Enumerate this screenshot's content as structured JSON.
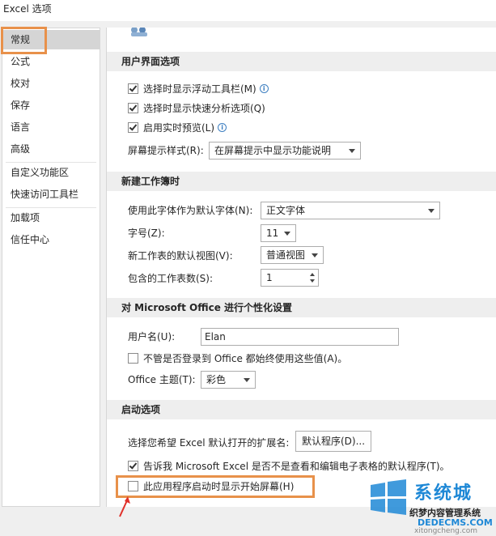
{
  "window": {
    "title": "Excel 选项"
  },
  "sidebar": {
    "items": [
      {
        "label": "常规",
        "selected": true
      },
      {
        "label": "公式"
      },
      {
        "label": "校对"
      },
      {
        "label": "保存"
      },
      {
        "label": "语言"
      },
      {
        "label": "高级"
      },
      {
        "label": "自定义功能区"
      },
      {
        "label": "快速访问工具栏"
      },
      {
        "label": "加载项"
      },
      {
        "label": "信任中心"
      }
    ]
  },
  "ui_options": {
    "header": "用户界面选项",
    "mini_toolbar": {
      "label": "选择时显示浮动工具栏(M)",
      "checked": true
    },
    "quick_analysis": {
      "label": "选择时显示快速分析选项(Q)",
      "checked": true
    },
    "live_preview": {
      "label": "启用实时预览(L)",
      "checked": true
    },
    "screentip_label": "屏幕提示样式(R):",
    "screentip_value": "在屏幕提示中显示功能说明"
  },
  "new_workbook": {
    "header": "新建工作簿时",
    "font_label": "使用此字体作为默认字体(N):",
    "font_value": "正文字体",
    "size_label": "字号(Z):",
    "size_value": "11",
    "view_label": "新工作表的默认视图(V):",
    "view_value": "普通视图",
    "sheets_label": "包含的工作表数(S):",
    "sheets_value": "1"
  },
  "personalize": {
    "header": "对 Microsoft Office 进行个性化设置",
    "username_label": "用户名(U):",
    "username_value": "Elan",
    "always_use": {
      "label": "不管是否登录到 Office 都始终使用这些值(A)。",
      "checked": false
    },
    "theme_label": "Office 主题(T):",
    "theme_value": "彩色"
  },
  "startup": {
    "header": "启动选项",
    "ext_label": "选择您希望 Excel 默认打开的扩展名:",
    "default_programs_button": "默认程序(D)...",
    "tell_me": {
      "label": "告诉我 Microsoft Excel 是否不是查看和编辑电子表格的默认程序(T)。",
      "checked": true
    },
    "show_start": {
      "label": "此应用程序启动时显示开始屏幕(H)",
      "checked": false
    }
  },
  "watermark": {
    "brand": "系统城",
    "site": "织梦内容管理系统",
    "domain": "DEDECMS.COM",
    "url": "xitongcheng.com"
  },
  "colors": {
    "highlight": "#e8914a",
    "annotation_arrow": "#e0302a",
    "info_icon": "#3d7fc1",
    "watermark_blue": "#1e88d6"
  }
}
